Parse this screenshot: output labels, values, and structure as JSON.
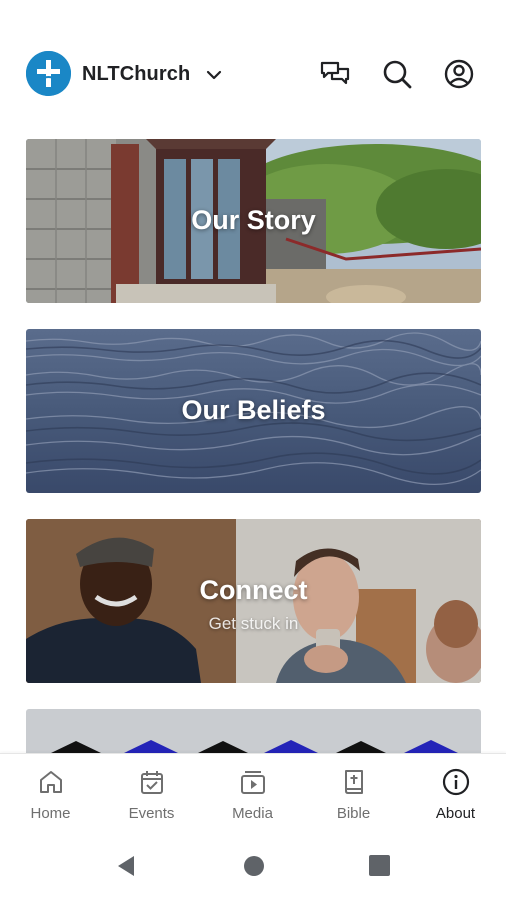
{
  "header": {
    "church_name": "NLTChurch",
    "logo_icon": "church-cross-icon",
    "actions": [
      "chat-icon",
      "search-icon",
      "account-icon"
    ]
  },
  "cards": [
    {
      "title": "Our Story",
      "subtitle": ""
    },
    {
      "title": "Our Beliefs",
      "subtitle": ""
    },
    {
      "title": "Connect",
      "subtitle": "Get stuck in"
    }
  ],
  "bottom_nav": {
    "items": [
      {
        "label": "Home",
        "icon": "home-icon"
      },
      {
        "label": "Events",
        "icon": "calendar-icon"
      },
      {
        "label": "Media",
        "icon": "media-icon"
      },
      {
        "label": "Bible",
        "icon": "bible-icon"
      },
      {
        "label": "About",
        "icon": "info-icon"
      }
    ],
    "active": "About"
  },
  "colors": {
    "brand": "#1a87c6",
    "text": "#202124",
    "nav_inactive": "#6f6f6f"
  }
}
